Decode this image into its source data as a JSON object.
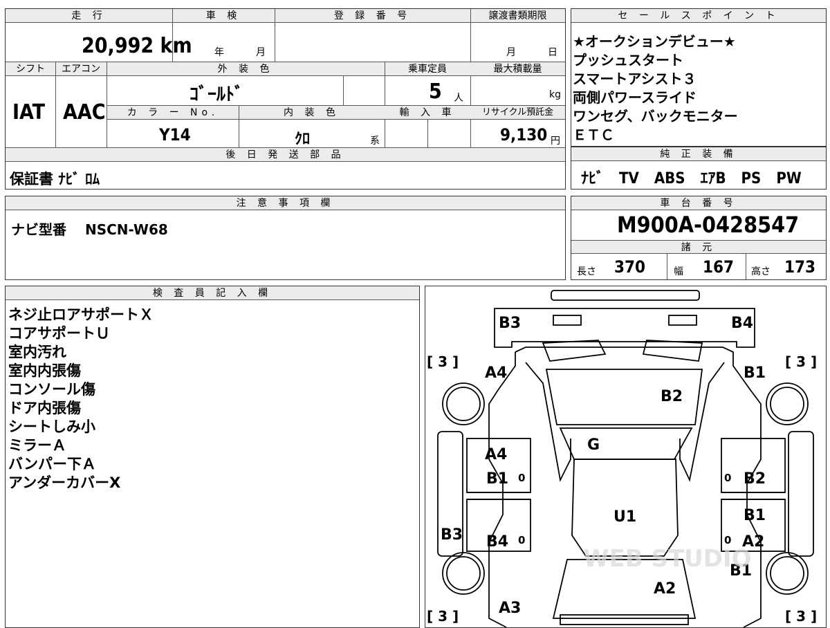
{
  "main": {
    "headers": {
      "mileage": "走 行",
      "inspection": "車 検",
      "registration": "登 録 番 号",
      "transfer_deadline": "譲渡書類期限",
      "shift": "シフト",
      "aircon": "エアコン",
      "exterior_color": "外 装 色",
      "capacity": "乗車定員",
      "max_load": "最大積載量",
      "color_no": "カ ラ ー No.",
      "interior_color": "内 装 色",
      "import": "輸 入 車",
      "recycle": "リサイクル預託金",
      "later_parts": "後 日 発 送 部 品"
    },
    "mileage_value": "20,992 km",
    "inspection_year": "年",
    "inspection_month": "月",
    "deadline_month": "月",
    "deadline_day": "日",
    "shift_value": "IAT",
    "aircon_value": "AAC",
    "exterior_color_value": "ｺﾞｰﾙﾄﾞ",
    "capacity_value": "5",
    "capacity_unit": "人",
    "max_load_unit": "kg",
    "color_no_value": "Y14",
    "interior_color_value": "ｸﾛ",
    "interior_color_suffix": "系",
    "recycle_value": "9,130",
    "recycle_unit": "円",
    "later_parts_value": "保証書 ﾅﾋﾞ ﾛﾑ"
  },
  "sales": {
    "header": "セ ー ル ス ポ イ ン ト",
    "lines": [
      "★オークションデビュー★",
      "プッシュスタート",
      "スマートアシスト３",
      "両側パワースライド",
      "ワンセグ、バックモニター",
      "ＥＴＣ"
    ]
  },
  "equipment": {
    "header": "純 正 装 備",
    "value": "ﾅﾋﾞ　TV　ABS　ｴｱB　PS　PW"
  },
  "notes": {
    "header": "注 意 事 項 欄",
    "value": "ナビ型番　 NSCN-W68"
  },
  "chassis": {
    "header": "車 台 番 号",
    "value": "M900A-0428547"
  },
  "specs": {
    "header": "諸 元",
    "length_label": "長さ",
    "length": "370",
    "width_label": "幅",
    "width": "167",
    "height_label": "高さ",
    "height": "173"
  },
  "inspector": {
    "header": "検 査 員 記 入 欄",
    "lines": [
      "ネジ止ロアサポートＸ",
      "コアサポートＵ",
      "室内汚れ",
      "室内内張傷",
      "コンソール傷",
      "ドア内張傷",
      "シートしみ小",
      "ミラーＡ",
      "バンパー下Ａ",
      "アンダーカバーX"
    ]
  },
  "diagram": {
    "marks": {
      "rear_left": "B3",
      "rear_right": "B4",
      "bracket_tl": "[ 3 ]",
      "bracket_tr": "[ 3 ]",
      "bracket_bl": "[ 3 ]",
      "bracket_br": "[ 3 ]",
      "a4_top": "A4",
      "b1_top_right": "B1",
      "b2_roof": "B2",
      "g_glass": "G",
      "a4_mid": "A4",
      "b1_mid_left": "B1",
      "b2_mid_right": "B2",
      "u1_floor": "U1",
      "b1_right_lower": "B1",
      "b3_left_side": "B3",
      "b4_lower_left": "B4",
      "a2_lower_right": "A2",
      "b1_bottom_right": "B1",
      "a2_bonnet": "A2",
      "a3_bottom_left": "A3",
      "zero_l1": "0",
      "zero_l2": "0",
      "zero_r1": "0",
      "zero_r2": "0"
    },
    "watermark": "WEB STUDIO"
  }
}
